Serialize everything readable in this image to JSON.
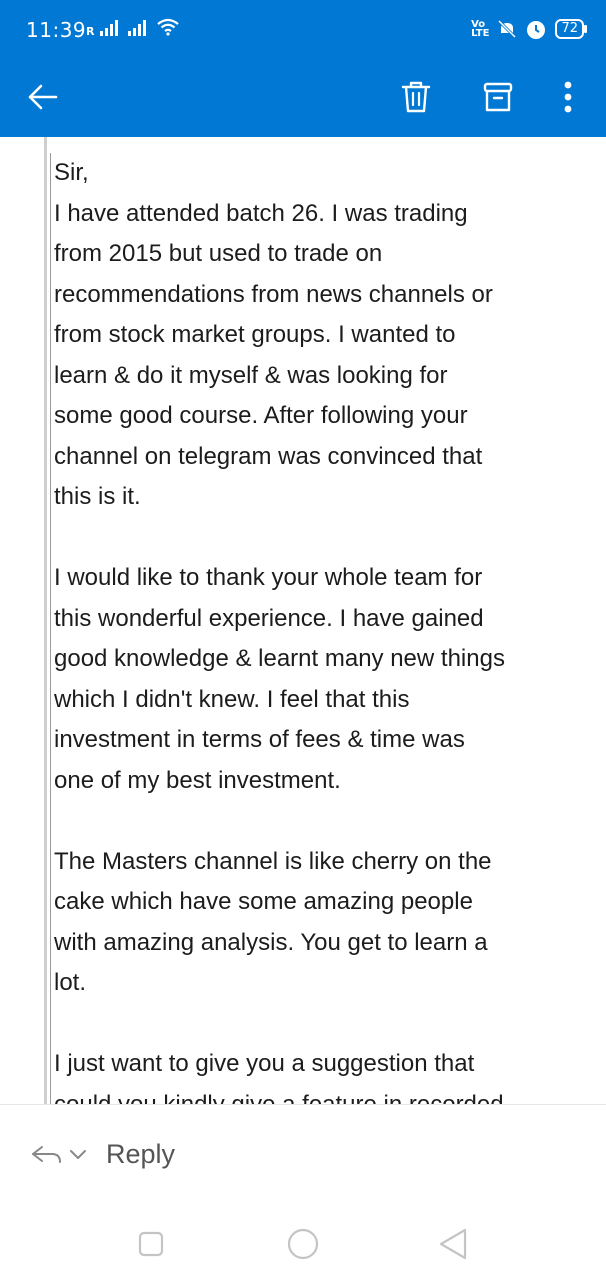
{
  "status_bar": {
    "time": "11:39",
    "network_type_label": "R",
    "volte_label_top": "Vo",
    "volte_label_bottom": "LTE",
    "battery_level": "72"
  },
  "app_bar": {
    "back_icon": "arrow-left-icon",
    "delete_icon": "trash-icon",
    "archive_icon": "archive-icon",
    "more_icon": "more-vertical-icon",
    "background_color": "#0078d4"
  },
  "email": {
    "lines": [
      "Sir,",
      "I have attended batch 26. I was trading",
      "from 2015 but used to trade on",
      "recommendations from news channels or",
      "from stock market groups. I wanted to",
      "learn & do it myself & was looking for",
      "some good course. After following your",
      "channel on telegram was convinced that",
      "this is it.",
      "",
      "I would like to thank your whole team for",
      "this wonderful experience. I have gained",
      "good knowledge & learnt many new things",
      "which I didn't knew. I feel that this",
      "investment in terms of fees & time was",
      "one of my best investment.",
      "",
      "The Masters channel is like cherry on the",
      "cake which have some amazing people",
      "with amazing analysis. You get to learn a",
      "lot.",
      "",
      "I just want to give you a suggestion that",
      "could you kindly give a feature in recorded"
    ]
  },
  "reply_bar": {
    "reply_label": "Reply",
    "reply_icon": "reply-arrow-icon",
    "options_icon": "chevron-down-icon"
  },
  "nav_bar": {
    "recents_icon": "square-icon",
    "home_icon": "circle-icon",
    "back_icon": "triangle-back-icon"
  }
}
